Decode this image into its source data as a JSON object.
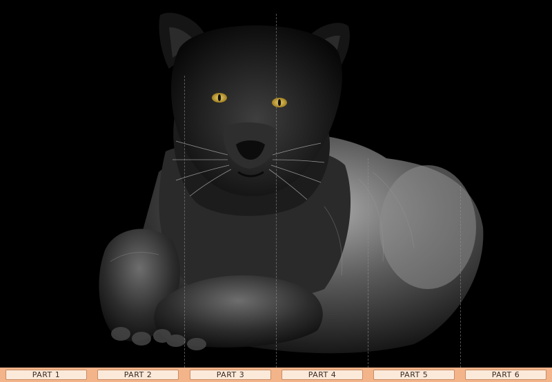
{
  "parts": [
    {
      "label": "PART 1"
    },
    {
      "label": "PART 2"
    },
    {
      "label": "PART 3"
    },
    {
      "label": "PART 4"
    },
    {
      "label": "PART 5"
    },
    {
      "label": "PART 6"
    }
  ],
  "colors": {
    "background": "#000000",
    "bar": "#f3b48a",
    "button_fill": "#fbe9da",
    "button_border": "#c88c64",
    "eyes": "#d8b14a"
  },
  "photo": {
    "subject_icon": "black-panther-photo"
  }
}
